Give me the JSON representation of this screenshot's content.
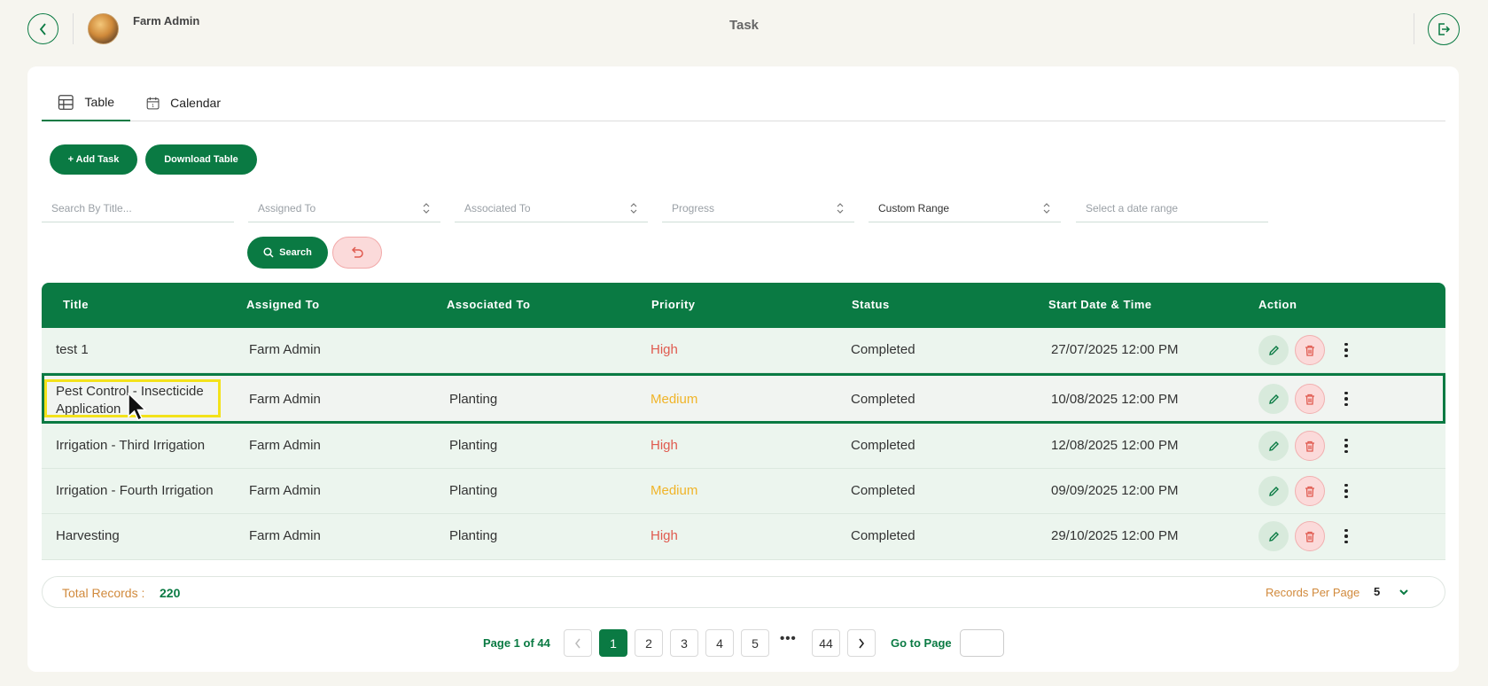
{
  "header": {
    "user_name": "Farm Admin",
    "page_title": "Task"
  },
  "tabs": [
    {
      "label": "Table",
      "icon": "table-icon",
      "active": true
    },
    {
      "label": "Calendar",
      "icon": "calendar-icon",
      "active": false
    }
  ],
  "toolbar": {
    "add_task_label": "+ Add Task",
    "download_label": "Download Table"
  },
  "filters": {
    "search_placeholder": "Search By Title...",
    "assigned_to": "Assigned To",
    "associated_to": "Associated To",
    "progress": "Progress",
    "date_mode": "Custom Range",
    "date_range_placeholder": "Select a date range",
    "search_button": "Search"
  },
  "table": {
    "columns": [
      "Title",
      "Assigned To",
      "Associated To",
      "Priority",
      "Status",
      "Start Date & Time",
      "Action"
    ],
    "rows": [
      {
        "title": "test 1",
        "title_line2": "",
        "assigned_to": "Farm Admin",
        "associated_to": "",
        "priority": "High",
        "status": "Completed",
        "start": "27/07/2025 12:00 PM"
      },
      {
        "title": "Pest Control - Insecticide",
        "title_line2": "Application",
        "assigned_to": "Farm Admin",
        "associated_to": "Planting",
        "priority": "Medium",
        "status": "Completed",
        "start": "10/08/2025 12:00 PM"
      },
      {
        "title": "Irrigation - Third Irrigation",
        "title_line2": "",
        "assigned_to": "Farm Admin",
        "associated_to": "Planting",
        "priority": "High",
        "status": "Completed",
        "start": "12/08/2025 12:00 PM"
      },
      {
        "title": "Irrigation - Fourth Irrigation",
        "title_line2": "",
        "assigned_to": "Farm Admin",
        "associated_to": "Planting",
        "priority": "Medium",
        "status": "Completed",
        "start": "09/09/2025 12:00 PM"
      },
      {
        "title": "Harvesting",
        "title_line2": "",
        "assigned_to": "Farm Admin",
        "associated_to": "Planting",
        "priority": "High",
        "status": "Completed",
        "start": "29/10/2025 12:00 PM"
      }
    ]
  },
  "footer": {
    "total_label": "Total Records :",
    "total_value": "220",
    "records_per_page_label": "Records Per Page",
    "records_per_page_value": "5"
  },
  "pagination": {
    "page_label": "Page 1 of 44",
    "pages": [
      "1",
      "2",
      "3",
      "4",
      "5"
    ],
    "ellipsis": "•••",
    "last_page": "44",
    "current": "1",
    "goto_label": "Go to Page"
  },
  "colors": {
    "primary": "#0a7a43",
    "high": "#e05a4f",
    "medium": "#f0b429",
    "accent_orange": "#d18a3c"
  }
}
